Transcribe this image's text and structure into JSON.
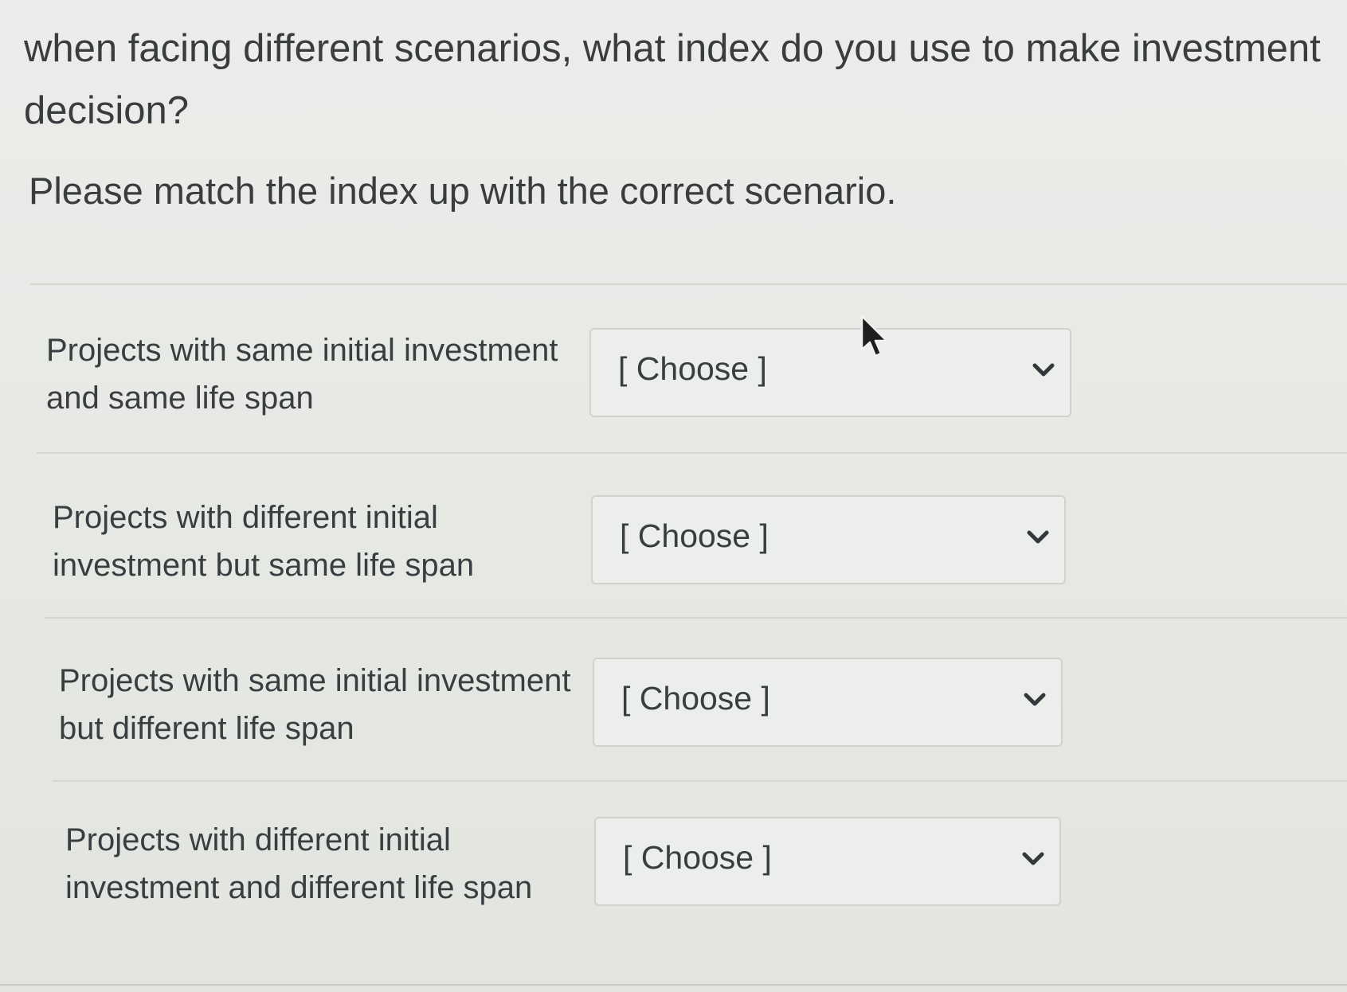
{
  "question": {
    "text": "when facing different scenarios, what index do you use to make investment decision?"
  },
  "instruction": {
    "text": "Please match the index up with the correct scenario."
  },
  "matches": [
    {
      "scenario": "Projects with same initial investment and same life span",
      "selected": "[ Choose ]"
    },
    {
      "scenario": "Projects with different initial investment but same life span",
      "selected": "[ Choose ]"
    },
    {
      "scenario": "Projects with same initial investment but different life span",
      "selected": "[ Choose ]"
    },
    {
      "scenario": "Projects with different initial investment and different life span",
      "selected": "[ Choose ]"
    }
  ],
  "icons": {
    "dropdown": "chevron-down-icon",
    "pointer": "mouse-cursor-icon"
  }
}
